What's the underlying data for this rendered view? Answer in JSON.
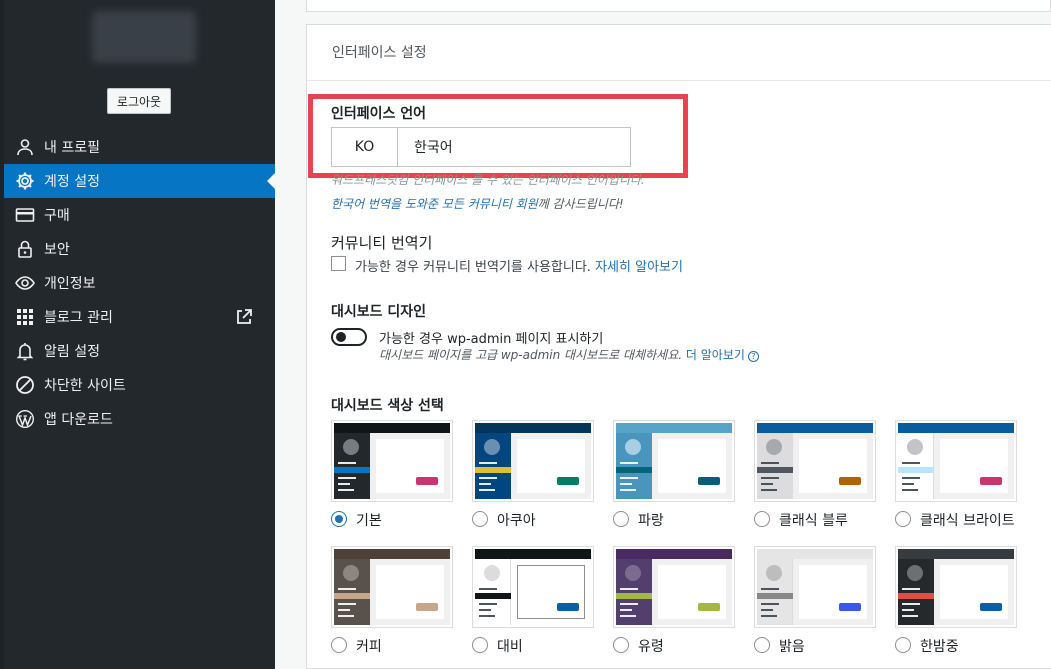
{
  "sidebar": {
    "logout_label": "로그아웃",
    "items": [
      {
        "label": "내 프로필",
        "icon": "user-icon",
        "name": "sidebar-item-profile"
      },
      {
        "label": "계정 설정",
        "icon": "gear-icon",
        "name": "sidebar-item-account-settings",
        "active": true
      },
      {
        "label": "구매",
        "icon": "credit-card-icon",
        "name": "sidebar-item-purchases"
      },
      {
        "label": "보안",
        "icon": "lock-icon",
        "name": "sidebar-item-security"
      },
      {
        "label": "개인정보",
        "icon": "eye-icon",
        "name": "sidebar-item-privacy"
      },
      {
        "label": "블로그 관리",
        "icon": "grid-icon",
        "name": "sidebar-item-manage-blogs",
        "external": true
      },
      {
        "label": "알림 설정",
        "icon": "bell-icon",
        "name": "sidebar-item-notifications"
      },
      {
        "label": "차단한 사이트",
        "icon": "block-icon",
        "name": "sidebar-item-blocked-sites"
      },
      {
        "label": "앱 다운로드",
        "icon": "wordpress-icon",
        "name": "sidebar-item-get-apps"
      }
    ]
  },
  "card": {
    "header": "인터페이스 설정",
    "language": {
      "label": "인터페이스 언어",
      "code": "KO",
      "name": "한국어",
      "hint_faded": "워드프레스닷컴 인터페이스 를 수 있는 인터페이스 언어입니다.",
      "thanks_link": "한국어 번역을 도와준 모든 커뮤니티 회원",
      "thanks_suffix": "께 감사드립니다!"
    },
    "community": {
      "title": "커뮤니티 번역기",
      "checkbox_label": "가능한 경우 커뮤니티 번역기를 사용합니다.",
      "link": "자세히 알아보기"
    },
    "dashboard_design": {
      "title": "대시보드 디자인",
      "toggle_label": "가능한 경우 wp-admin 페이지 표시하기",
      "desc": "대시보드 페이지를 고급 wp-admin 대시보드로 대체하세요.",
      "link": "더 알아보기",
      "help_icon": "?"
    },
    "color_scheme": {
      "title": "대시보드 색상 선택",
      "schemes": [
        {
          "label": "기본",
          "checked": true,
          "top": "#101517",
          "side": "#23282d",
          "active": "#0675c4",
          "avatar": "#787c82",
          "content": "#f0f0f1",
          "btn": "#c9356e"
        },
        {
          "label": "아쿠아",
          "top": "#04365c",
          "side": "#01467e",
          "active": "#dfbf2a",
          "avatar": "#6b8fb0",
          "content": "#f0f0f1",
          "btn": "#007e65"
        },
        {
          "label": "파랑",
          "top": "#57a4c9",
          "side": "#4995be",
          "active": "#056579",
          "avatar": "#a7cfe1",
          "content": "#f0f0f1",
          "btn": "#085d77"
        },
        {
          "label": "클래식 블루",
          "top": "#0a5d9c",
          "side": "#dcdcde",
          "active": "#50575e",
          "avatar": "#a7aaad",
          "content": "#f0f0f1",
          "btn": "#b26200"
        },
        {
          "label": "클래식 브라이트",
          "top": "#0a5d9c",
          "side": "#ffffff",
          "active": "#b8e6ff",
          "avatar": "#c3c4c7",
          "content": "#f0f0f1",
          "btn": "#c9356e"
        },
        {
          "label": "커피",
          "top": "#4c4038",
          "side": "#59524c",
          "active": "#c7a589",
          "avatar": "#8c8580",
          "content": "#f0f0f1",
          "btn": "#c7a589"
        },
        {
          "label": "대비",
          "top": "#101517",
          "side": "#ffffff",
          "active": "#101517",
          "avatar": "#dcdcde",
          "content": "#ffffff",
          "btn": "#0b5fa3"
        },
        {
          "label": "유령",
          "top": "#4a2b61",
          "side": "#523f6d",
          "active": "#a3b745",
          "avatar": "#7c6b91",
          "content": "#f0f0f1",
          "btn": "#a3b745"
        },
        {
          "label": "밝음",
          "top": "#e5e5e5",
          "side": "#e5e5e5",
          "active": "#888888",
          "avatar": "#bdbdbd",
          "content": "#f0f0f1",
          "btn": "#3858e9"
        },
        {
          "label": "한밤중",
          "top": "#363b3f",
          "side": "#26292c",
          "active": "#e14d43",
          "avatar": "#6d6f72",
          "content": "#f0f0f1",
          "btn": "#0b5fa3"
        }
      ]
    }
  }
}
